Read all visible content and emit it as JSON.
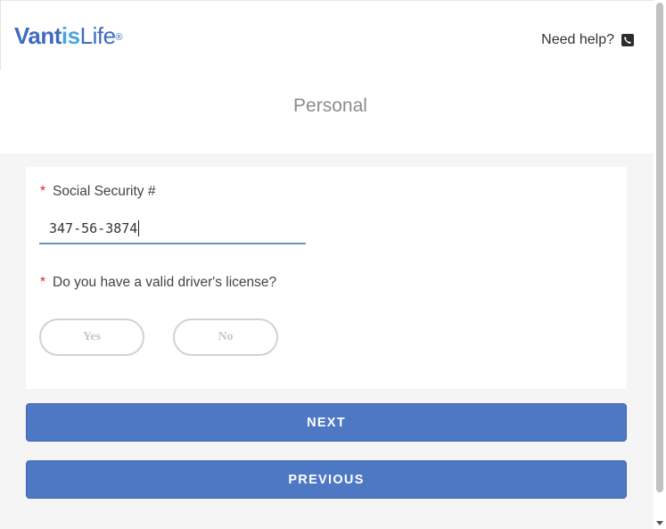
{
  "header": {
    "logo": {
      "brand_bold": "Vantis",
      "brand_accent": "",
      "brand_light": "Life",
      "reg_mark": "®"
    },
    "help_label": "Need help?",
    "help_icon": "phone-icon"
  },
  "page": {
    "title": "Personal"
  },
  "form": {
    "ssn": {
      "required_mark": "*",
      "label": "Social Security #",
      "value": "347-56-3874"
    },
    "drivers_license": {
      "required_mark": "*",
      "label": "Do you have a valid driver's license?",
      "options": {
        "yes": "Yes",
        "no": "No"
      }
    }
  },
  "actions": {
    "next": "NEXT",
    "previous": "PREVIOUS"
  },
  "colors": {
    "primary": "#4f78c4",
    "logo_blue": "#3d6cc0",
    "logo_accent": "#4aa6de",
    "required": "#e0202a"
  }
}
